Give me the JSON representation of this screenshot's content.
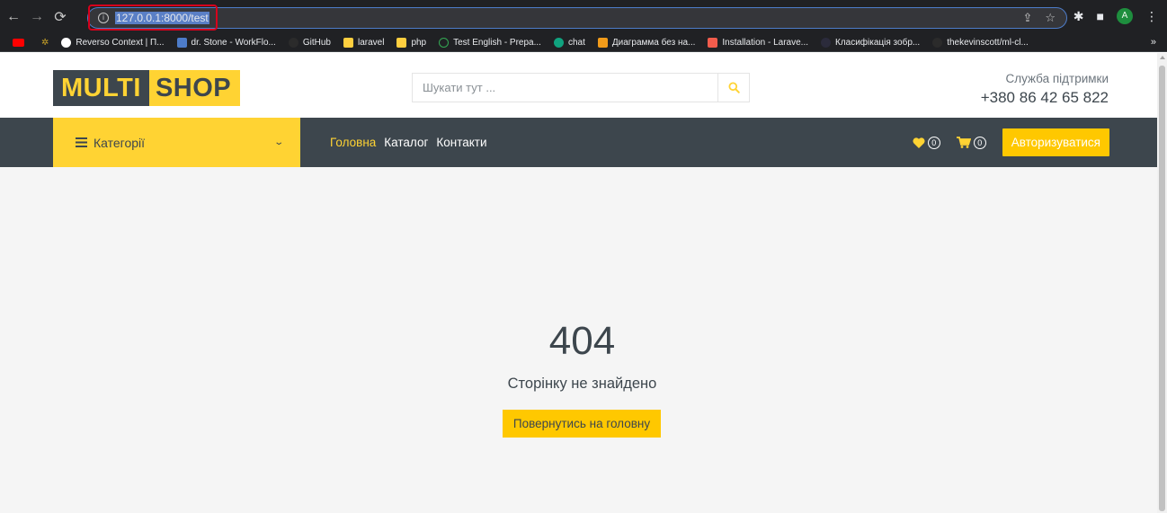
{
  "browser": {
    "url": "127.0.0.1:8000/test",
    "profile_initial": "A",
    "bookmarks": [
      {
        "label": "Reverso Context | П...",
        "color": "#ffffff"
      },
      {
        "label": "dr. Stone - WorkFlo...",
        "color": "#4d7cc9"
      },
      {
        "label": "GitHub",
        "color": "#2b2b2b"
      },
      {
        "label": "laravel",
        "color": "#ffcf3f"
      },
      {
        "label": "php",
        "color": "#ffcf3f"
      },
      {
        "label": "Test English - Prepa...",
        "color": "#34a853"
      },
      {
        "label": "chat",
        "color": "#10a37f"
      },
      {
        "label": "Диаграмма без на...",
        "color": "#f19b1a"
      },
      {
        "label": "Installation - Larave...",
        "color": "#f25c4c"
      },
      {
        "label": "Класифікація зобр...",
        "color": "#2b2b3b"
      },
      {
        "label": "thekevinscott/ml-cl...",
        "color": "#2b2b2b"
      }
    ],
    "bookmarks_more": "»"
  },
  "header": {
    "logo_part1": "MULTI",
    "logo_part2": "SHOP",
    "search_placeholder": "Шукати тут ...",
    "support_label": "Служба підтримки",
    "support_phone": "+380 86 42 65 822"
  },
  "navbar": {
    "categories_label": "Категорії",
    "links": [
      {
        "label": "Головна",
        "active": true
      },
      {
        "label": "Каталог",
        "active": false
      },
      {
        "label": "Контакти",
        "active": false
      }
    ],
    "wishlist_count": "0",
    "cart_count": "0",
    "auth_label": "Авторизуватися"
  },
  "error": {
    "code": "404",
    "message": "Сторінку не знайдено",
    "home_button": "Повернутись на головну"
  },
  "colors": {
    "brand_yellow": "#ffd333",
    "button_yellow": "#ffc800",
    "dark": "#3d464d"
  }
}
